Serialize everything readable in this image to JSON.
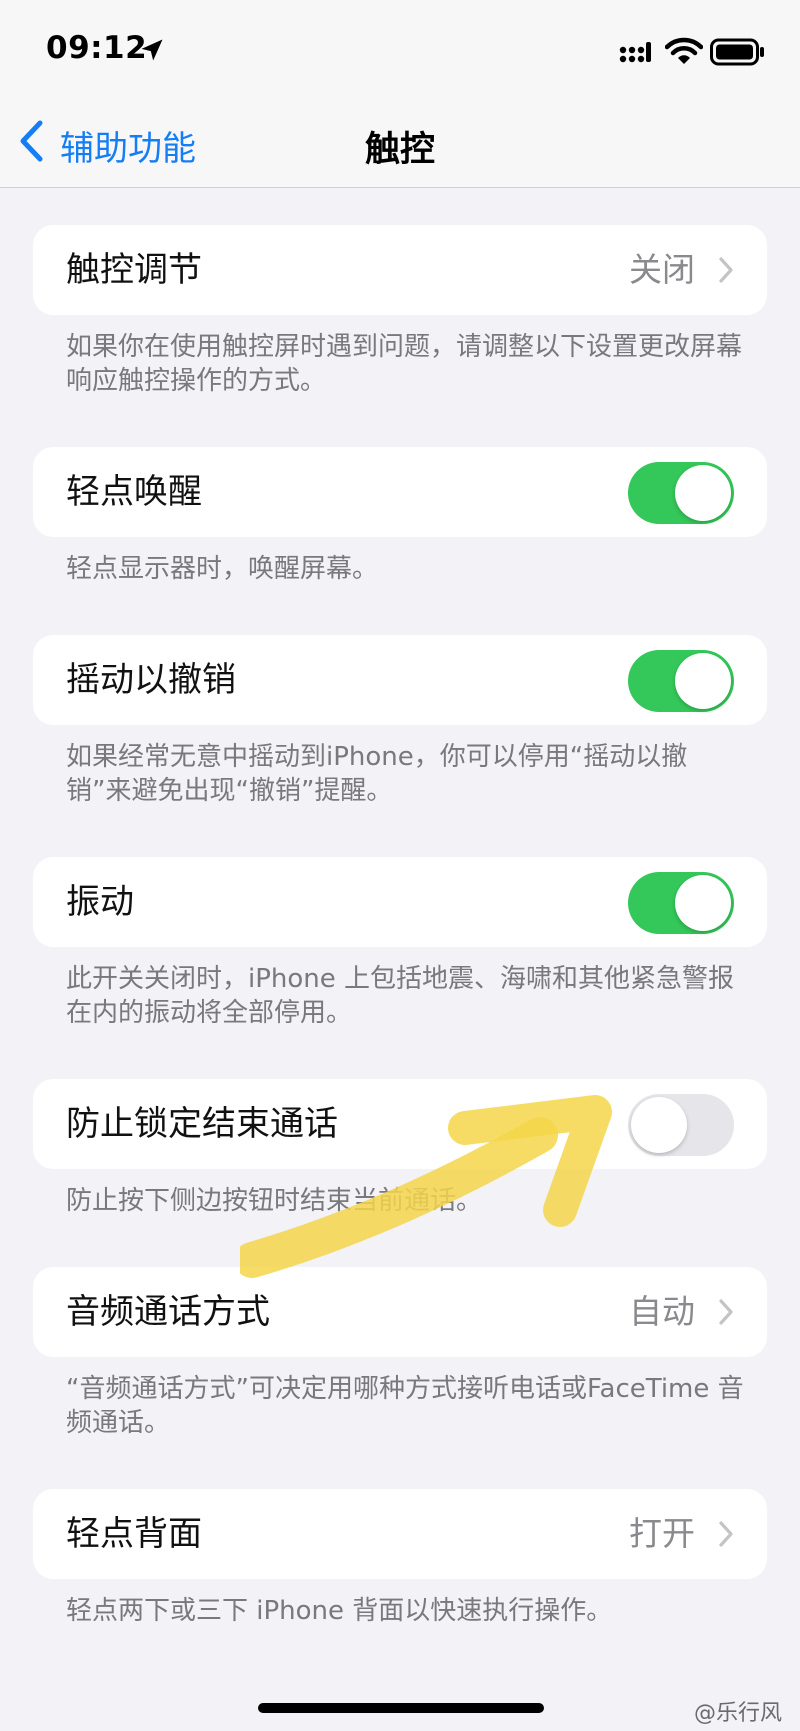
{
  "status_bar": {
    "time": "09:12"
  },
  "nav": {
    "back_label": "辅助功能",
    "title": "触控"
  },
  "sections": [
    {
      "label": "触控调节",
      "value": "关闭",
      "footer": "如果你在使用触控屏时遇到问题，请调整以下设置更改屏幕响应触控操作的方式。"
    },
    {
      "label": "轻点唤醒",
      "toggle": true,
      "footer": "轻点显示器时，唤醒屏幕。"
    },
    {
      "label": "摇动以撤销",
      "toggle": true,
      "footer": "如果经常无意中摇动到iPhone，你可以停用“摇动以撤销”来避免出现“撤销”提醒。"
    },
    {
      "label": "振动",
      "toggle": true,
      "footer": "此开关关闭时，iPhone 上包括地震、海啸和其他紧急警报在内的振动将全部停用。"
    },
    {
      "label": "防止锁定结束通话",
      "toggle": false,
      "footer": "防止按下侧边按钮时结束当前通话。"
    },
    {
      "label": "音频通话方式",
      "value": "自动",
      "footer": "“音频通话方式”可决定用哪种方式接听电话或FaceTime 音频通话。"
    },
    {
      "label": "轻点背面",
      "value": "打开",
      "footer": "轻点两下或三下 iPhone 背面以快速执行操作。"
    }
  ],
  "watermark": "@乐行风",
  "colors": {
    "accent": "#157ef5",
    "toggle_on": "#34c759",
    "toggle_off": "#e5e5ea",
    "highlight": "#f5d64a"
  },
  "icons": [
    "location-arrow-icon",
    "cellular-signal-icon",
    "wifi-icon",
    "battery-icon",
    "back-chevron-icon",
    "chevron-right-icon"
  ]
}
